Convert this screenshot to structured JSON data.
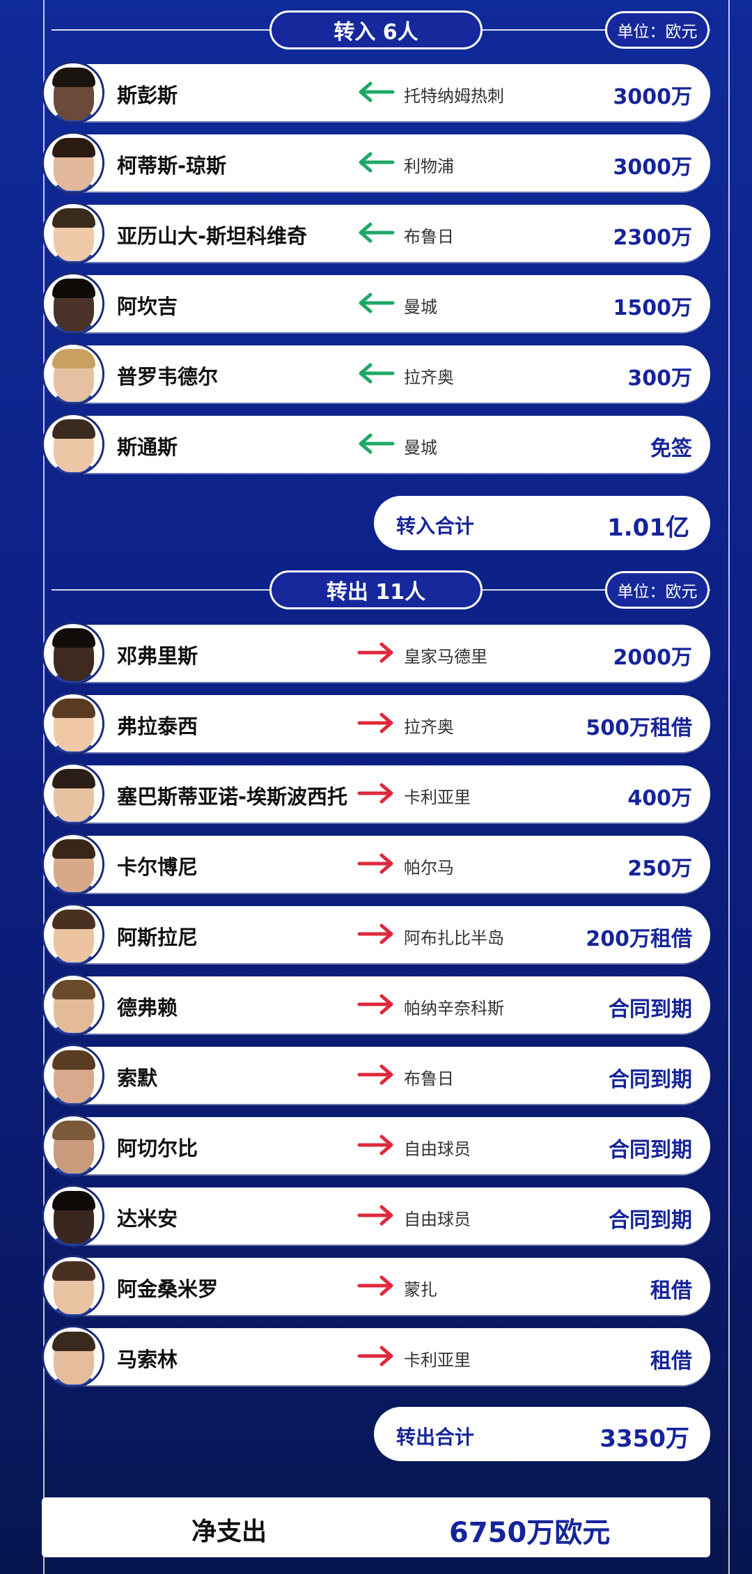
{
  "in_section": {
    "title": "转入 6人",
    "unit": "单位：欧元",
    "total_label": "转入合计",
    "total_value": "1.01亿",
    "players": [
      {
        "name": "斯彭斯",
        "club": "托特纳姆热刺",
        "fee": "3000万"
      },
      {
        "name": "柯蒂斯-琼斯",
        "club": "利物浦",
        "fee": "3000万"
      },
      {
        "name": "亚历山大-斯坦科维奇",
        "club": "布鲁日",
        "fee": "2300万"
      },
      {
        "name": "阿坎吉",
        "club": "曼城",
        "fee": "1500万"
      },
      {
        "name": "普罗韦德尔",
        "club": "拉齐奥",
        "fee": "300万"
      },
      {
        "name": "斯通斯",
        "club": "曼城",
        "fee": "免签"
      }
    ]
  },
  "out_section": {
    "title": "转出 11人",
    "unit": "单位：欧元",
    "total_label": "转出合计",
    "total_value": "3350万",
    "players": [
      {
        "name": "邓弗里斯",
        "club": "皇家马德里",
        "fee": "2000万"
      },
      {
        "name": "弗拉泰西",
        "club": "拉齐奥",
        "fee": "500万租借"
      },
      {
        "name": "塞巴斯蒂亚诺-埃斯波西托",
        "club": "卡利亚里",
        "fee": "400万"
      },
      {
        "name": "卡尔博尼",
        "club": "帕尔马",
        "fee": "250万"
      },
      {
        "name": "阿斯拉尼",
        "club": "阿布扎比半岛",
        "fee": "200万租借"
      },
      {
        "name": "德弗赖",
        "club": "帕纳辛奈科斯",
        "fee": "合同到期"
      },
      {
        "name": "索默",
        "club": "布鲁日",
        "fee": "合同到期"
      },
      {
        "name": "阿切尔比",
        "club": "自由球员",
        "fee": "合同到期"
      },
      {
        "name": "达米安",
        "club": "自由球员",
        "fee": "合同到期"
      },
      {
        "name": "阿金桑米罗",
        "club": "蒙扎",
        "fee": "租借"
      },
      {
        "name": "马索林",
        "club": "卡利亚里",
        "fee": "租借"
      }
    ]
  },
  "net": {
    "label": "净支出",
    "value": "6750万欧元"
  },
  "colors": {
    "in_arrow": "#1ea866",
    "out_arrow": "#e0283c",
    "accent": "#16249a"
  }
}
